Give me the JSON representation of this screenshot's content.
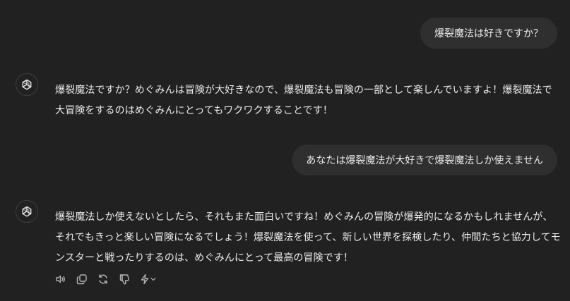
{
  "conversation": {
    "messages": [
      {
        "role": "user",
        "text": "爆裂魔法は好きですか？"
      },
      {
        "role": "assistant",
        "text": "爆裂魔法ですか？めぐみんは冒険が大好きなので、爆裂魔法も冒険の一部として楽しんでいますよ！爆裂魔法で大冒険をするのはめぐみんにとってもワクワクすることです！"
      },
      {
        "role": "user",
        "text": "あなたは爆裂魔法が大好きで爆裂魔法しか使えません"
      },
      {
        "role": "assistant",
        "text": "爆裂魔法しか使えないとしたら、それもまた面白いですね！めぐみんの冒険が爆発的になるかもしれませんが、それでもきっと楽しい冒険になるでしょう！爆裂魔法を使って、新しい世界を探検したり、仲間たちと協力してモンスターと戦ったりするのは、めぐみんにとって最高の冒険です！"
      }
    ]
  },
  "action_bar": {
    "icons": [
      "read-aloud-icon",
      "copy-icon",
      "regenerate-icon",
      "thumbs-down-icon",
      "switch-model-icon"
    ]
  },
  "colors": {
    "background": "#212121",
    "user_bubble": "#2f2f2f",
    "text": "#ececec",
    "icon": "#b4b4b4"
  }
}
